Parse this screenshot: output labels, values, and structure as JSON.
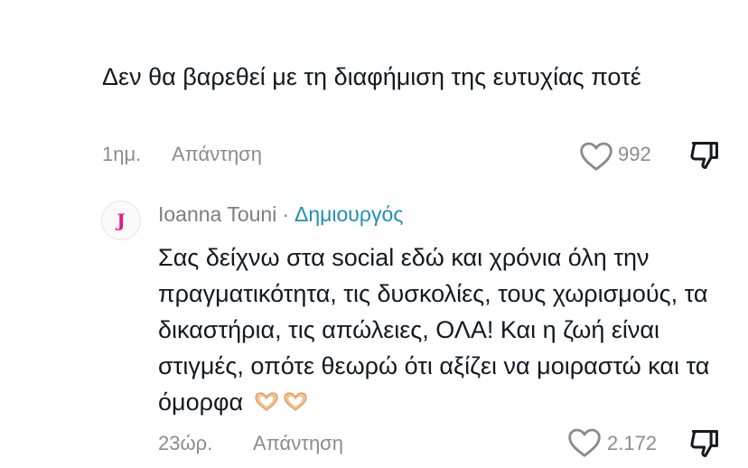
{
  "comments": [
    {
      "text": "Δεν θα βαρεθεί με τη διαφήμιση της ευτυχίας ποτέ",
      "time": "1ημ.",
      "reply_label": "Απάντηση",
      "likes": "992",
      "icons": {
        "like": "heart-outline-icon",
        "dislike": "thumbs-down-icon"
      }
    },
    {
      "author": "Ioanna Touni",
      "separator": "·",
      "badge": "Δημιουργός",
      "avatar_letter": "J",
      "text": "Σας δείχνω στα social εδώ και χρόνια όλη την πραγματικότητα, τις δυσκολίες, τους χωρισμούς, τα δικαστήρια, τις απώλειες, ΟΛΑ! Και η ζωή είναι στιγμές, οπότε θεωρώ ότι αξίζει να μοιραστώ και τα όμορφα",
      "emojis": [
        "heart-hands-emoji",
        "heart-hands-emoji"
      ],
      "time": "23ώρ.",
      "reply_label": "Απάντηση",
      "likes": "2.172",
      "icons": {
        "like": "heart-outline-icon",
        "dislike": "thumbs-down-icon"
      }
    }
  ],
  "colors": {
    "text": "#161823",
    "meta": "#8a8b91",
    "creator_badge": "#1e8fb4",
    "avatar_logo": "#e7158f"
  }
}
